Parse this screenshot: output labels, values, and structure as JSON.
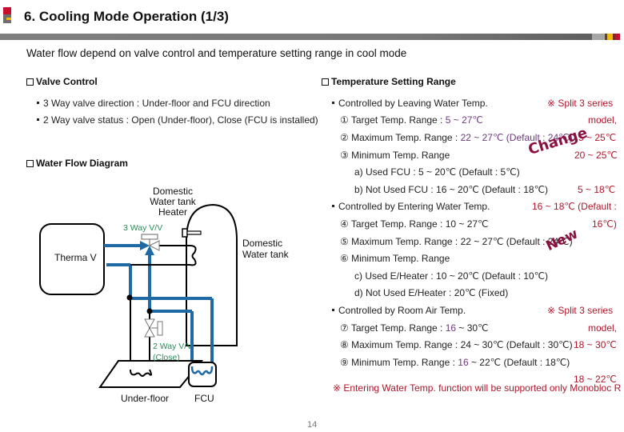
{
  "header": {
    "title": "6. Cooling Mode Operation (1/3)",
    "chip_colors": [
      "#a6a6a6",
      "#5a4a2a",
      "#f5b800",
      "#7a2a2a",
      "#c8102e"
    ]
  },
  "subtitle": "Water flow depend on valve control and temperature setting range in cool mode",
  "valve_control": {
    "heading": "Valve Control",
    "items": [
      "3 Way valve direction : Under-floor and FCU direction",
      "2 Way valve status : Open (Under-floor), Close (FCU is installed)"
    ]
  },
  "water_flow": {
    "heading": "Water Flow Diagram",
    "labels": {
      "heater": [
        "Domestic",
        "Water tank",
        "Heater"
      ],
      "tank": [
        "Domestic",
        "Water tank"
      ],
      "therma": "Therma V",
      "three_way": "3 Way V/V",
      "two_way": [
        "2 Way V/V",
        "(Close)"
      ],
      "underfloor": "Under-floor",
      "fcu": "FCU"
    },
    "pipe_color": "#1f6aa5"
  },
  "temperature": {
    "heading": "Temperature Setting Range",
    "leaving": {
      "label": "Controlled by Leaving Water Temp.",
      "lines": [
        {
          "prefix": "① Target Temp. Range : ",
          "value": "5 ~ 27℃"
        },
        {
          "prefix": "② Maximum Temp. Range : ",
          "value": "22 ~ 27℃ (Default : 24℃)"
        },
        {
          "prefix": "③ Minimum Temp. Range",
          "value": ""
        },
        {
          "prefix": "a) Used FCU : 5 ~ 20℃ (Default : 5℃)",
          "value": ""
        },
        {
          "prefix": "b) Not Used FCU : 16 ~ 20℃ (Default : 18℃)",
          "value": ""
        }
      ],
      "notes": [
        "※ Split 3 series",
        "model,",
        "5 ~ 25℃",
        "20 ~ 25℃",
        "5 ~ 18℃",
        "16 ~ 18℃ (Default :",
        "16℃)"
      ],
      "stamp": "Change"
    },
    "entering": {
      "label": "Controlled by Entering Water Temp.",
      "lines": [
        "④ Target Temp. Range : 10 ~ 27℃",
        "⑤ Maximum Temp. Range : 22 ~ 27℃ (Default : 24℃)",
        "⑥ Minimum Temp. Range",
        "c) Used E/Heater : 10 ~ 20℃ (Default : 10℃)",
        "d) Not Used E/Heater : 20℃ (Fixed)"
      ],
      "stamp": "New"
    },
    "room_air": {
      "label": "Controlled by Room Air Temp.",
      "lines": [
        {
          "prefix": "⑦ Target Temp. Range : ",
          "purple": "16",
          "suffix": " ~ 30℃"
        },
        {
          "prefix": "⑧ Maximum Temp. Range : 24 ~ 30℃ (Default : 30℃)",
          "purple": "",
          "suffix": ""
        },
        {
          "prefix": "⑨ Minimum Temp. Range : ",
          "purple": "16",
          "suffix": " ~ 22℃ (Default : 18℃)"
        }
      ],
      "notes": [
        "※ Split 3 series",
        "model,",
        "18 ~ 30℃",
        "18 ~ 22℃"
      ]
    },
    "footnote": "※ Entering Water Temp. function will be supported only Monobloc R"
  },
  "page_number": "14"
}
